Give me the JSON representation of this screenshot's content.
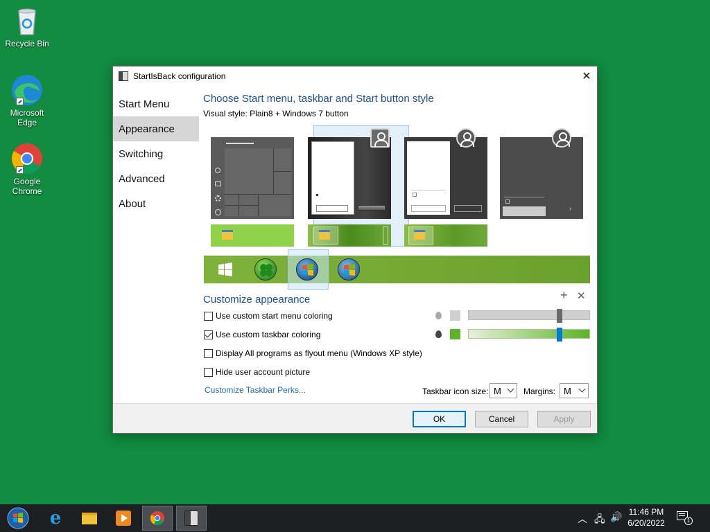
{
  "desktop": {
    "icons": [
      {
        "label": "Recycle Bin"
      },
      {
        "label": "Microsoft Edge"
      },
      {
        "label": "Google Chrome"
      }
    ]
  },
  "dialog": {
    "title": "StartIsBack configuration",
    "nav": [
      "Start Menu",
      "Appearance",
      "Switching",
      "Advanced",
      "About"
    ],
    "active_nav": "Appearance",
    "section_title": "Choose Start menu, taskbar and Start button style",
    "visual_style": "Visual style:  Plain8 + Windows 7 button",
    "customize_title": "Customize appearance",
    "options": [
      {
        "label": "Use custom start menu coloring",
        "checked": false
      },
      {
        "label": "Use custom taskbar coloring",
        "checked": true
      },
      {
        "label": "Display All programs as flyout menu (Windows XP style)",
        "checked": false
      },
      {
        "label": "Hide user account picture",
        "checked": false
      }
    ],
    "link": "Customize Taskbar Perks...",
    "icon_size_label": "Taskbar icon size:",
    "icon_size_value": "M",
    "margins_label": "Margins:",
    "margins_value": "M",
    "buttons": {
      "ok": "OK",
      "cancel": "Cancel",
      "apply": "Apply"
    },
    "colors": {
      "start_swatch": "#cfcfcf",
      "taskbar_swatch": "#5fb32a",
      "accent": "#0078d7"
    }
  },
  "taskbar": {
    "time": "11:46 PM",
    "date": "6/20/2022",
    "notification_count": "1"
  }
}
